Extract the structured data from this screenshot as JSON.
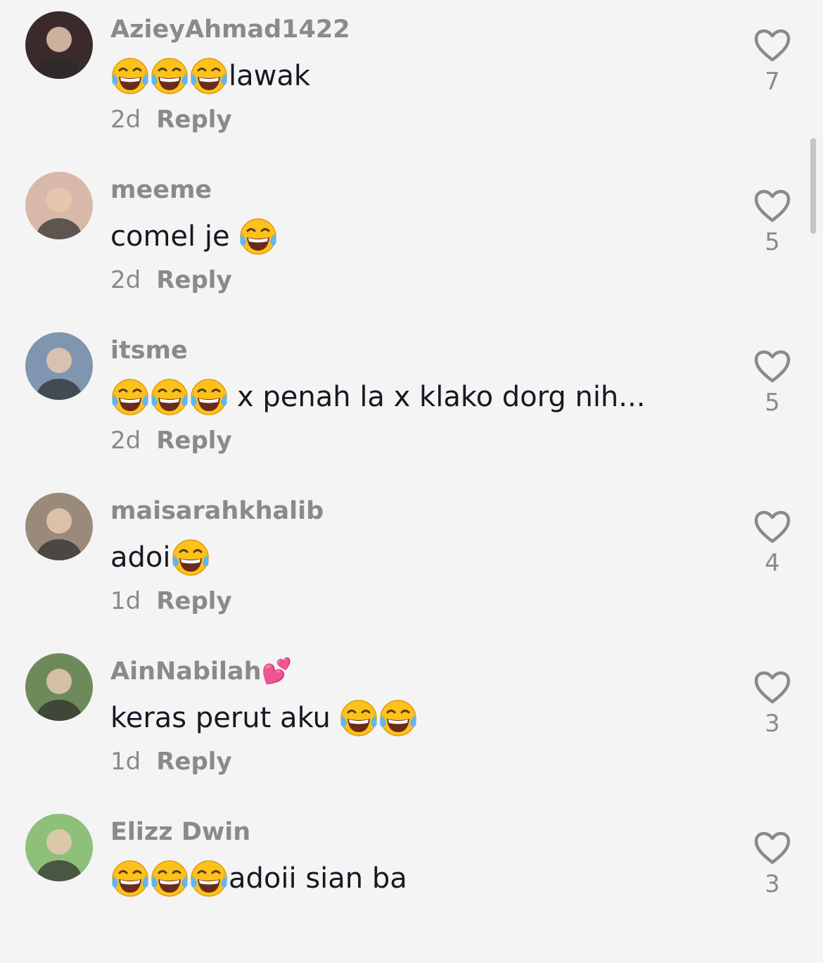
{
  "comments": [
    {
      "username": "AzieyAhmad1422",
      "before": "",
      "emojis_before": 3,
      "text": "lawak",
      "emojis_after": 0,
      "time": "2d",
      "reply": "Reply",
      "likes": "7",
      "avatar_color": "#3a2a2a"
    },
    {
      "username": "meeme",
      "before": "comel je",
      "emojis_before": 0,
      "text": "",
      "emojis_after": 1,
      "time": "2d",
      "reply": "Reply",
      "likes": "5",
      "avatar_color": "#d8b8a8"
    },
    {
      "username": "itsme",
      "before": "",
      "emojis_before": 3,
      "text": "x penah la x klako dorg nih...",
      "emojis_after": 0,
      "time": "2d",
      "reply": "Reply",
      "likes": "5",
      "avatar_color": "#7f95b0"
    },
    {
      "username": "maisarahkhalib",
      "before": "adoi",
      "emojis_before": 0,
      "text": "",
      "emojis_after": 1,
      "time": "1d",
      "reply": "Reply",
      "likes": "4",
      "avatar_color": "#9a8a7a"
    },
    {
      "username": "AinNabilah💕",
      "before": "keras perut aku",
      "emojis_before": 0,
      "text": "",
      "emojis_after": 2,
      "time": "1d",
      "reply": "Reply",
      "likes": "3",
      "avatar_color": "#6e8a5a"
    },
    {
      "username": "Elizz Dwin",
      "before": "",
      "emojis_before": 3,
      "text": "adoii sian ba",
      "emojis_after": 0,
      "time": "",
      "reply": "",
      "likes": "3",
      "avatar_color": "#8fc07a"
    }
  ],
  "icons": {
    "like": "heart-outline-icon",
    "emoji": "face-with-tears-of-joy-icon"
  },
  "colors": {
    "background": "#f4f4f4",
    "secondary_text": "#8a8a8a",
    "primary_text": "#161823"
  }
}
